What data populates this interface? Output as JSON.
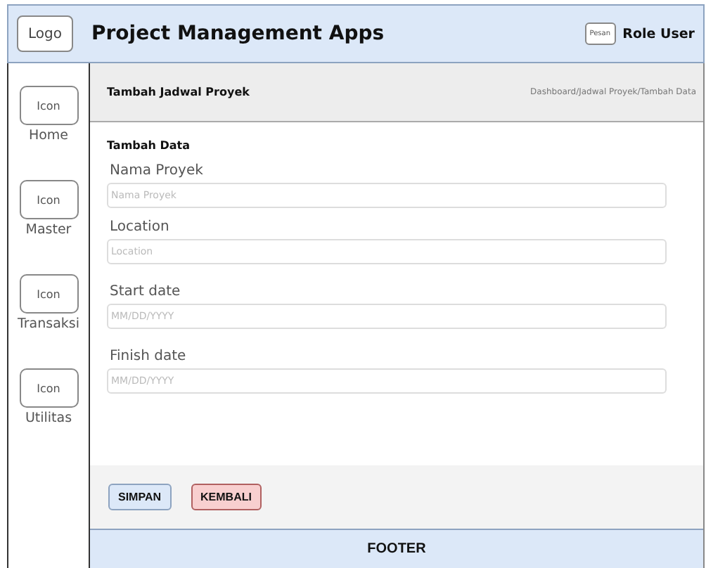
{
  "header": {
    "logo": "Logo",
    "title": "Project Management Apps",
    "message_button": "Pesan",
    "user": "Role User"
  },
  "sidebar": {
    "items": [
      {
        "icon": "Icon",
        "label": "Home"
      },
      {
        "icon": "Icon",
        "label": "Master"
      },
      {
        "icon": "Icon",
        "label": "Transaksi"
      },
      {
        "icon": "Icon",
        "label": "Utilitas"
      }
    ]
  },
  "page": {
    "title": "Tambah Jadwal Proyek",
    "breadcrumb": "Dashboard/Jadwal Proyek/Tambah Data"
  },
  "form": {
    "title": "Tambah Data",
    "fields": [
      {
        "label": "Nama Proyek",
        "placeholder": "Nama Proyek"
      },
      {
        "label": "Location",
        "placeholder": "Location"
      },
      {
        "label": "Start date",
        "placeholder": "MM/DD/YYYY"
      },
      {
        "label": "Finish date",
        "placeholder": "MM/DD/YYYY"
      }
    ]
  },
  "buttons": [
    {
      "label": "SIMPAN",
      "kind": "primary"
    },
    {
      "label": "KEMBALI",
      "kind": "danger"
    }
  ],
  "footer": "FOOTER"
}
